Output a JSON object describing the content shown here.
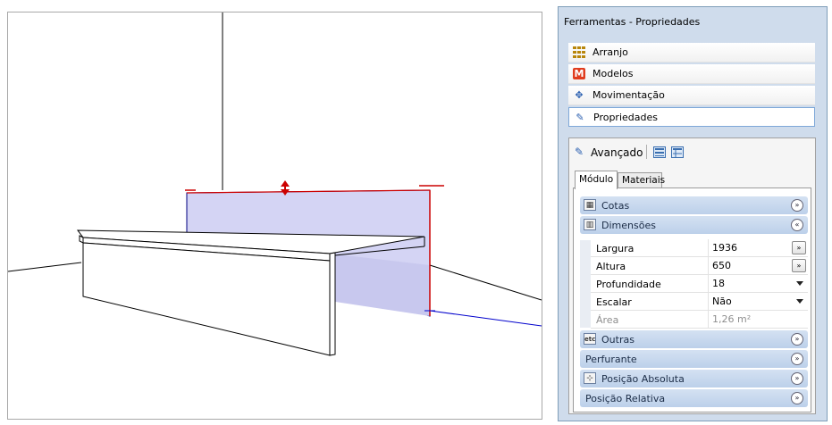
{
  "panel": {
    "title": "Ferramentas - Propriedades",
    "nav_items": [
      {
        "label": "Arranjo",
        "icon": "grid-icon"
      },
      {
        "label": "Modelos",
        "icon": "models-m-icon"
      },
      {
        "label": "Movimentação",
        "icon": "move-arrows-icon"
      },
      {
        "label": "Propriedades",
        "icon": "properties-icon",
        "selected": true
      }
    ],
    "advanced": {
      "label": "Avançado"
    },
    "tabs": [
      {
        "label": "Módulo",
        "active": true
      },
      {
        "label": "Materiais",
        "active": false
      }
    ],
    "sections": {
      "cotas": {
        "label": "Cotas",
        "icon": "cotas-icon",
        "chevron": "»"
      },
      "dimensoes": {
        "label": "Dimensões",
        "icon": "dimensions-icon",
        "chevron": "«"
      },
      "outras": {
        "label": "Outras",
        "icon": "etc",
        "chevron": "»"
      },
      "perfurante": {
        "label": "Perfurante",
        "chevron": "»"
      },
      "posicao_absoluta": {
        "label": "Posição Absoluta",
        "icon": "xyz-icon",
        "chevron": "»"
      },
      "posicao_relativa": {
        "label": "Posição Relativa",
        "chevron": "»"
      }
    },
    "properties": [
      {
        "name": "Largura",
        "value": "1936",
        "control": "button",
        "button_label": "»"
      },
      {
        "name": "Altura",
        "value": "650",
        "control": "button",
        "button_label": "»"
      },
      {
        "name": "Profundidade",
        "value": "18",
        "control": "dropdown"
      },
      {
        "name": "Escalar",
        "value": "Não",
        "control": "dropdown"
      },
      {
        "name": "Área",
        "value": "1,26 m²",
        "control": "none",
        "disabled": true
      }
    ]
  },
  "colors": {
    "panel_bg": "#cfdcec",
    "section_bar": "#c6d7ee",
    "selection_fill": "#d4d4f4",
    "selection_edge": "#000080",
    "axis_red": "#cc0000",
    "axis_blue": "#0000cc"
  }
}
